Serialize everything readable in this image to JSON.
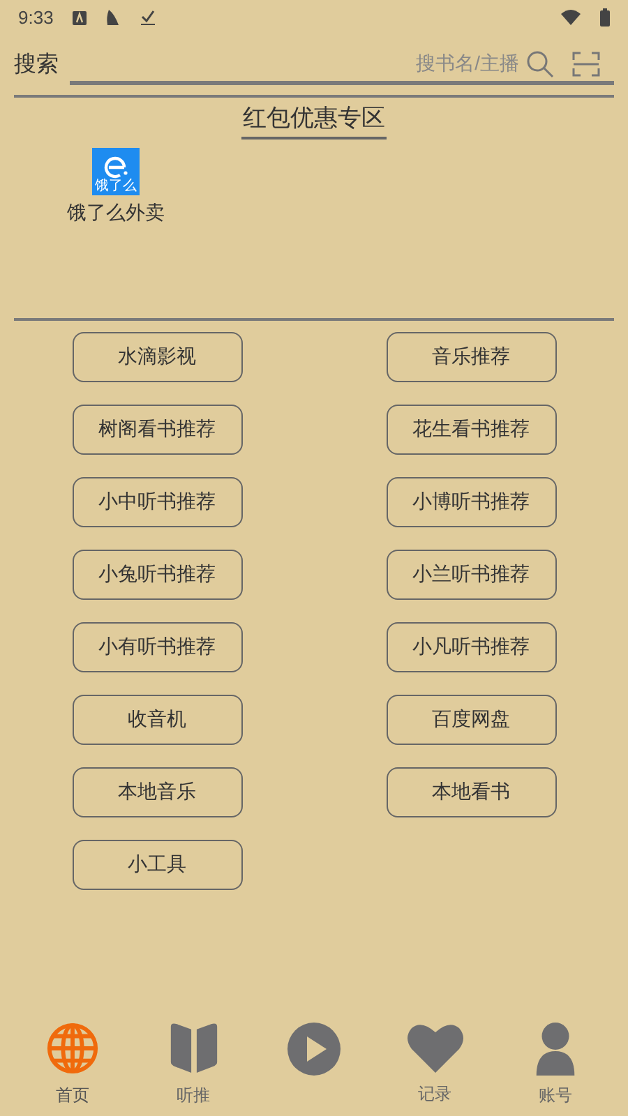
{
  "status_bar": {
    "time": "9:33"
  },
  "search": {
    "label": "搜索",
    "placeholder": "搜书名/主播"
  },
  "promo": {
    "title": "红包优惠专区",
    "items": [
      {
        "logo_text": "饿了么",
        "label": "饿了么外卖"
      }
    ]
  },
  "links": [
    {
      "label": "水滴影视"
    },
    {
      "label": "音乐推荐"
    },
    {
      "label": "树阁看书推荐"
    },
    {
      "label": "花生看书推荐"
    },
    {
      "label": "小中听书推荐"
    },
    {
      "label": "小博听书推荐"
    },
    {
      "label": "小兔听书推荐"
    },
    {
      "label": "小兰听书推荐"
    },
    {
      "label": "小有听书推荐"
    },
    {
      "label": "小凡听书推荐"
    },
    {
      "label": "收音机"
    },
    {
      "label": "百度网盘"
    },
    {
      "label": "本地音乐"
    },
    {
      "label": "本地看书"
    },
    {
      "label": "小工具"
    }
  ],
  "nav": [
    {
      "kind": "globe",
      "label": "首页",
      "selected": true
    },
    {
      "kind": "book",
      "label": "听推",
      "selected": false
    },
    {
      "kind": "play",
      "selected": false
    },
    {
      "kind": "heart",
      "label": "记录",
      "selected": false
    },
    {
      "kind": "person",
      "label": "账号",
      "selected": false
    }
  ]
}
